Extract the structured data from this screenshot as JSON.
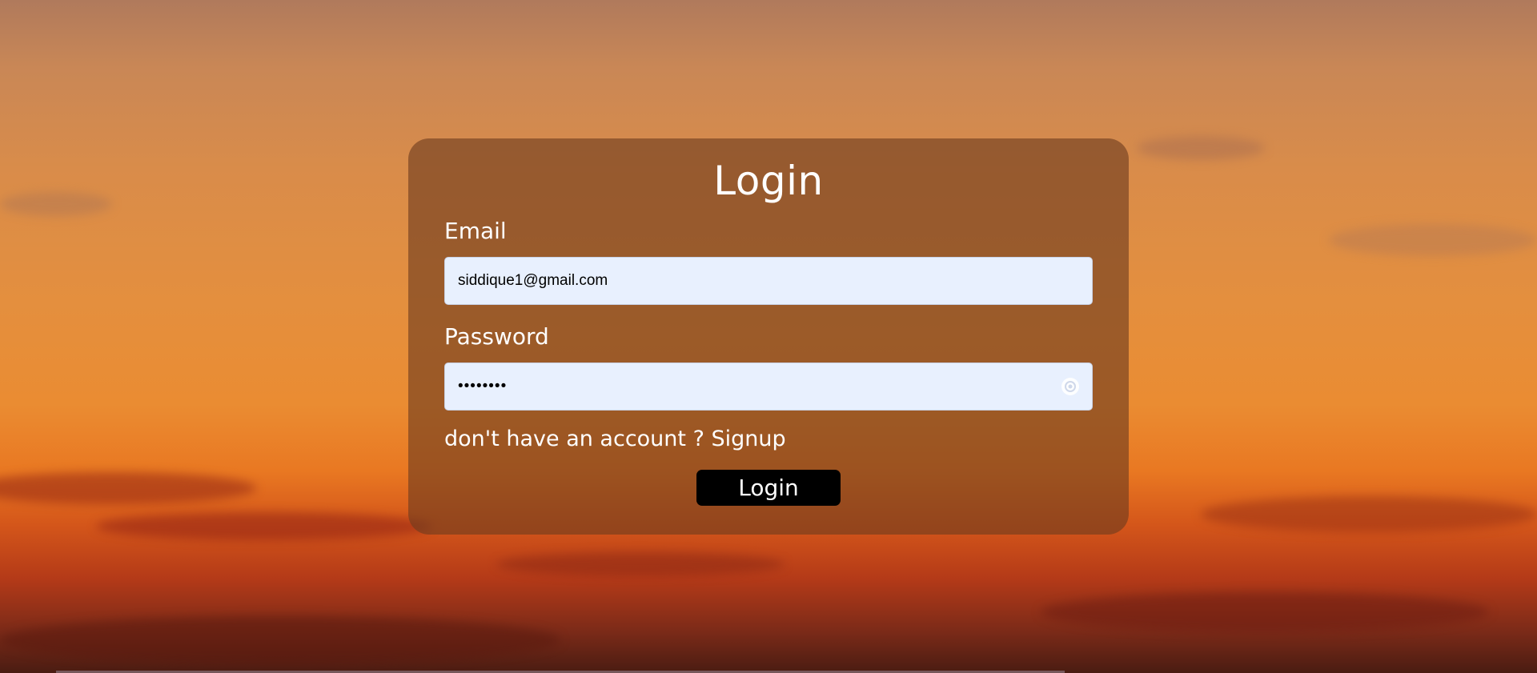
{
  "form": {
    "title": "Login",
    "email_label": "Email",
    "email_value": "siddique1@gmail.com",
    "password_label": "Password",
    "password_value": "••••••••",
    "signup_prompt": "don't have an account ?",
    "signup_link": "Signup",
    "submit_label": "Login"
  },
  "icons": {
    "password_toggle": "eye-icon"
  },
  "colors": {
    "card_background": "#6e3c1e",
    "input_background": "#e8f0fe",
    "button_background": "#000000",
    "text": "#ffffff"
  }
}
